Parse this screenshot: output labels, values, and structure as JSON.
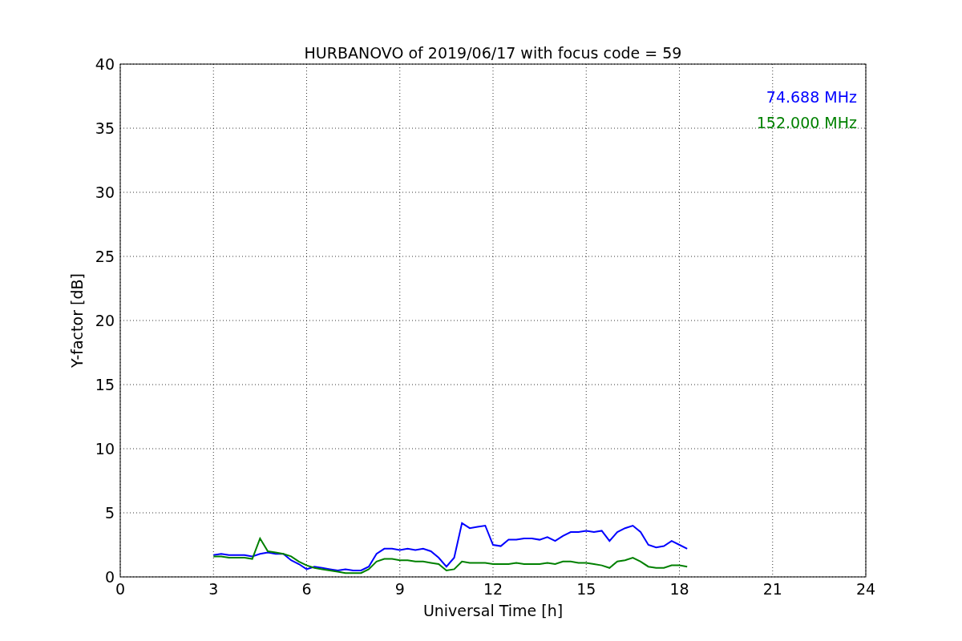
{
  "chart_data": {
    "type": "line",
    "title": "HURBANOVO of 2019/06/17 with focus code = 59",
    "xlabel": "Universal Time [h]",
    "ylabel": "Y-factor [dB]",
    "x": [
      3,
      3.25,
      3.5,
      3.75,
      4,
      4.25,
      4.5,
      4.75,
      5,
      5.25,
      5.5,
      5.75,
      6,
      6.25,
      6.5,
      6.75,
      7,
      7.25,
      7.5,
      7.75,
      8,
      8.25,
      8.5,
      8.75,
      9,
      9.25,
      9.5,
      9.75,
      10,
      10.25,
      10.5,
      10.75,
      11,
      11.25,
      11.5,
      11.75,
      12,
      12.25,
      12.5,
      12.75,
      13,
      13.25,
      13.5,
      13.75,
      14,
      14.25,
      14.5,
      14.75,
      15,
      15.25,
      15.5,
      15.75,
      16,
      16.25,
      16.5,
      16.75,
      17,
      17.25,
      17.5,
      17.75,
      18,
      18.25
    ],
    "series": [
      {
        "name": "74.688 MHz",
        "color": "#0000ff",
        "values": [
          1.7,
          1.8,
          1.7,
          1.7,
          1.7,
          1.6,
          1.8,
          1.9,
          1.8,
          1.8,
          1.3,
          1.0,
          0.6,
          0.8,
          0.7,
          0.6,
          0.5,
          0.6,
          0.5,
          0.5,
          0.8,
          1.8,
          2.2,
          2.2,
          2.1,
          2.2,
          2.1,
          2.2,
          2.0,
          1.5,
          0.8,
          1.5,
          4.2,
          3.8,
          3.9,
          4.0,
          2.5,
          2.4,
          2.9,
          2.9,
          3.0,
          3.0,
          2.9,
          3.1,
          2.8,
          3.2,
          3.5,
          3.5,
          3.6,
          3.5,
          3.6,
          2.8,
          3.5,
          3.8,
          4.0,
          3.5,
          2.5,
          2.3,
          2.4,
          2.8,
          2.5,
          2.2
        ]
      },
      {
        "name": "152.000 MHz",
        "color": "#008000",
        "values": [
          1.6,
          1.6,
          1.5,
          1.5,
          1.5,
          1.4,
          3.0,
          2.0,
          1.9,
          1.8,
          1.6,
          1.2,
          0.9,
          0.7,
          0.6,
          0.5,
          0.4,
          0.3,
          0.3,
          0.3,
          0.6,
          1.2,
          1.4,
          1.4,
          1.3,
          1.3,
          1.2,
          1.2,
          1.1,
          1.0,
          0.5,
          0.6,
          1.2,
          1.1,
          1.1,
          1.1,
          1.0,
          1.0,
          1.0,
          1.1,
          1.0,
          1.0,
          1.0,
          1.1,
          1.0,
          1.2,
          1.2,
          1.1,
          1.1,
          1.0,
          0.9,
          0.7,
          1.2,
          1.3,
          1.5,
          1.2,
          0.8,
          0.7,
          0.7,
          0.9,
          0.9,
          0.8
        ]
      }
    ],
    "xlim": [
      0,
      24
    ],
    "ylim": [
      0,
      40
    ],
    "xticks": [
      0,
      3,
      6,
      9,
      12,
      15,
      18,
      21,
      24
    ],
    "yticks": [
      0,
      5,
      10,
      15,
      20,
      25,
      30,
      35,
      40
    ],
    "grid": true
  }
}
